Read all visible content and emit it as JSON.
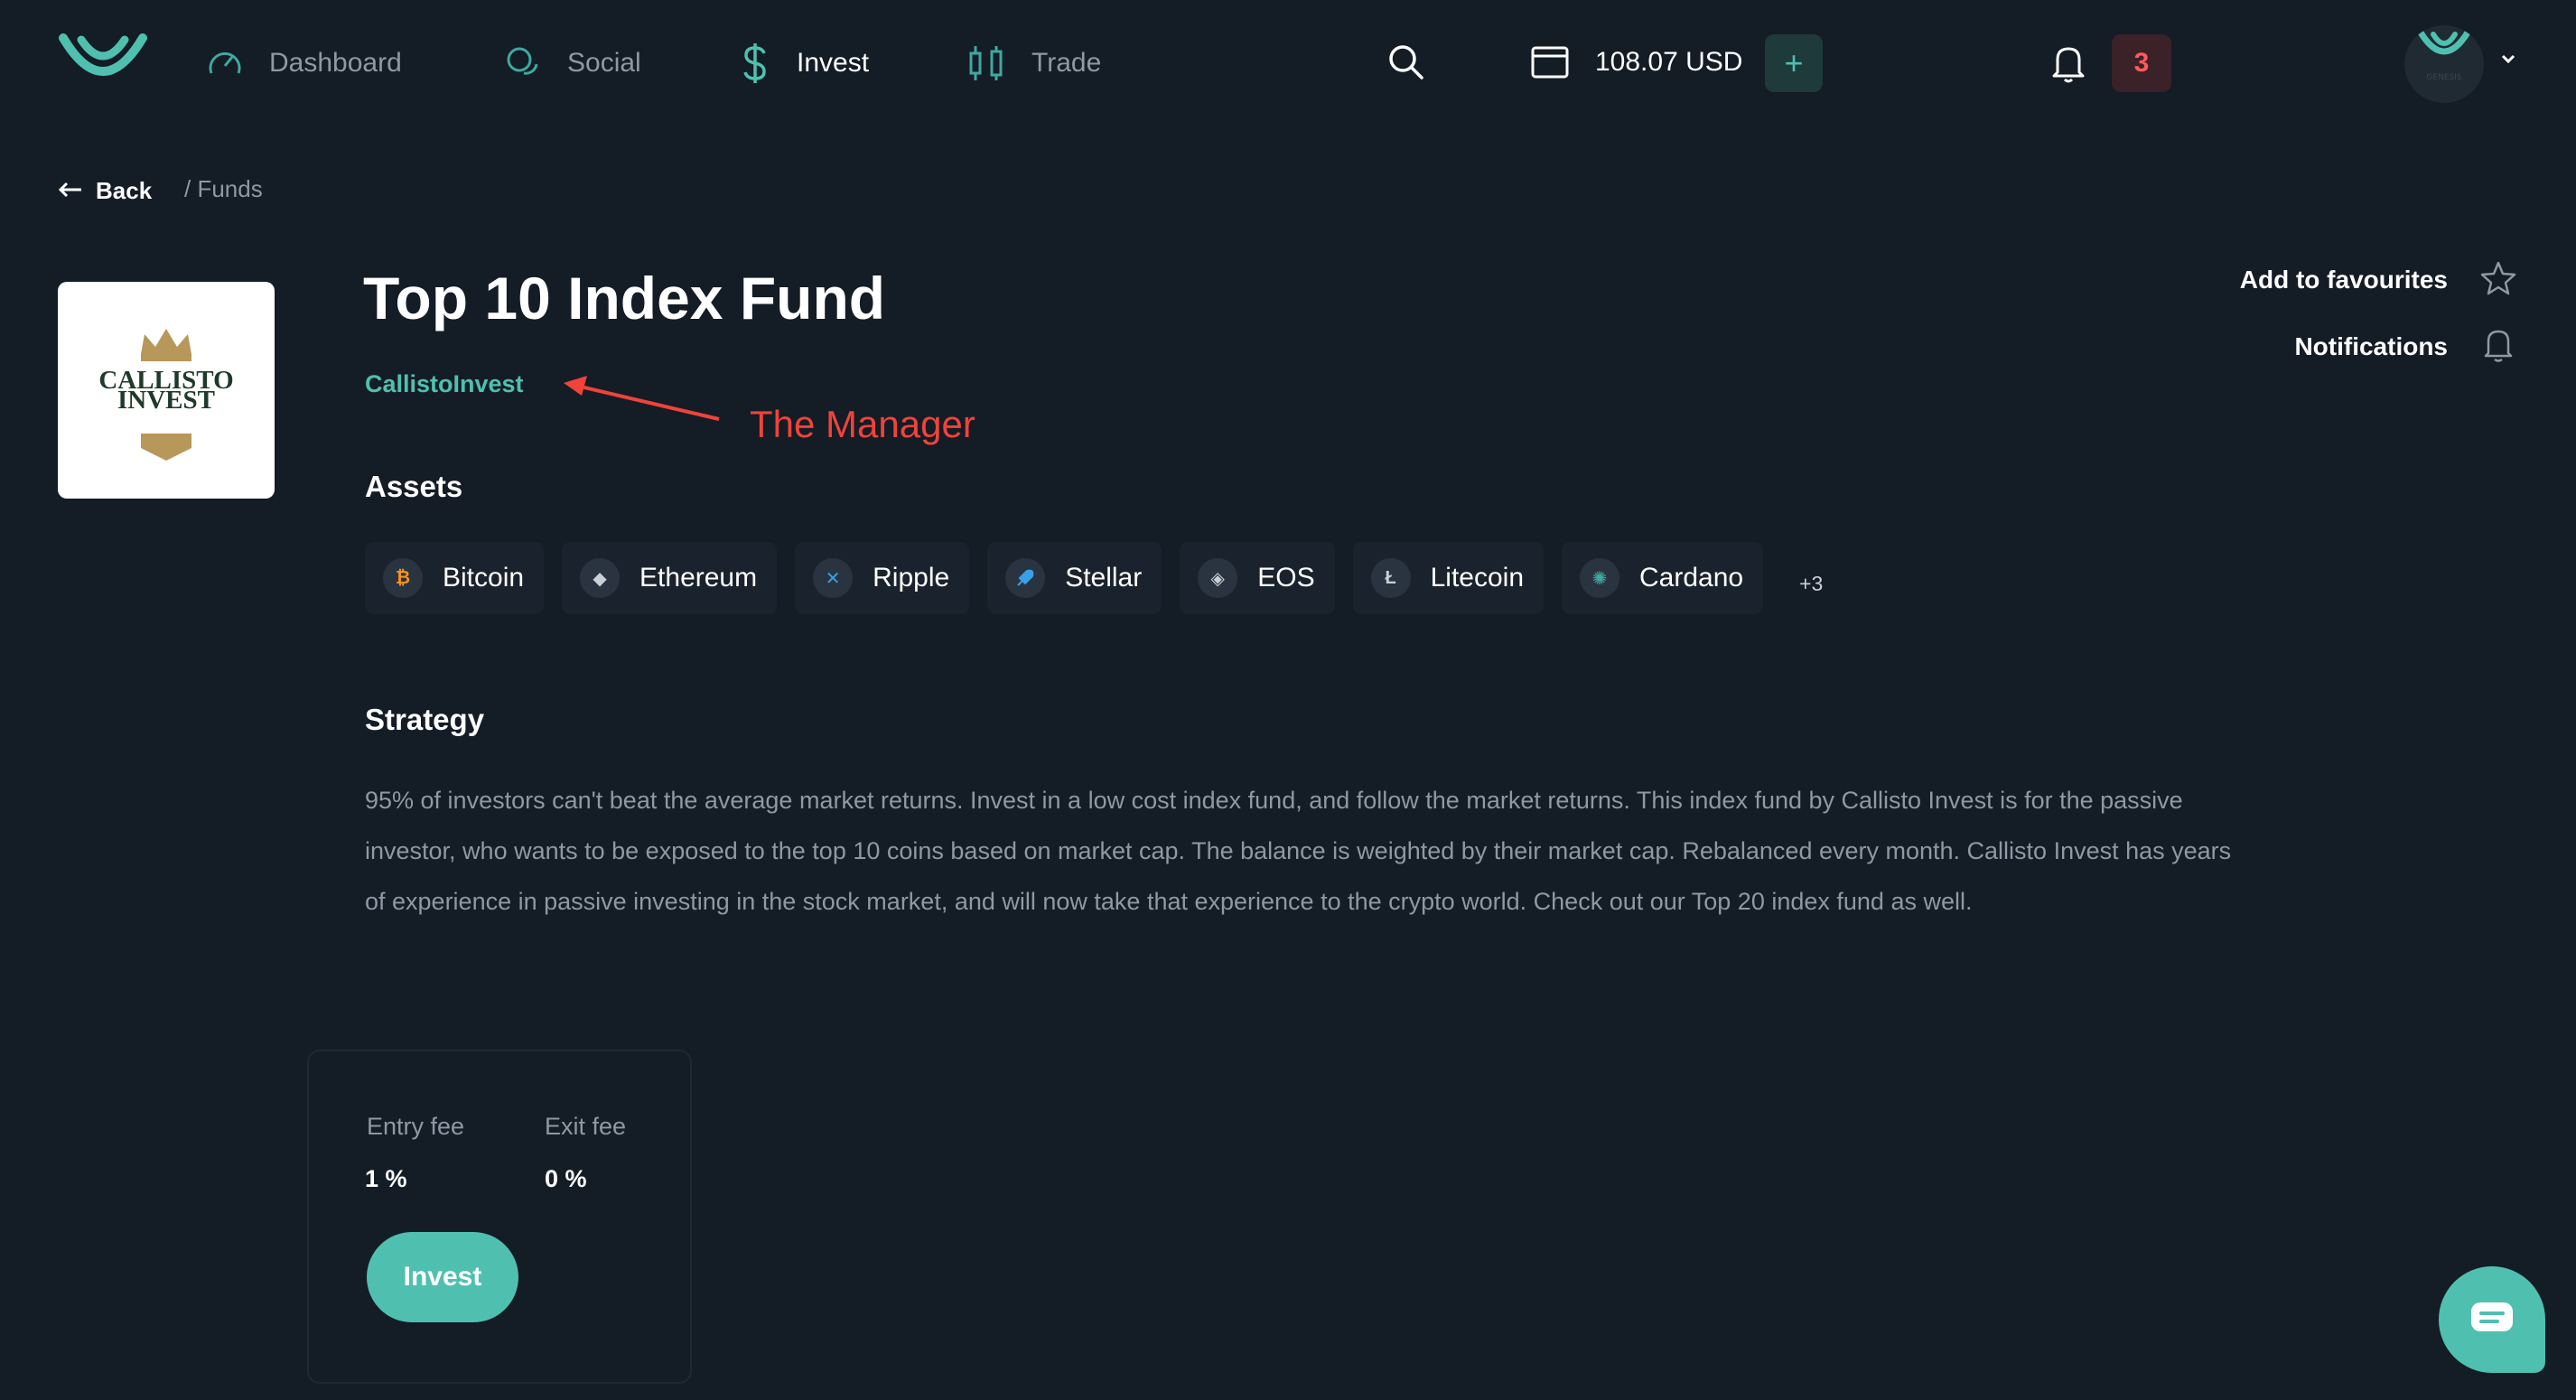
{
  "nav": {
    "items": [
      {
        "label": "Dashboard",
        "icon": "gauge-icon"
      },
      {
        "label": "Social",
        "icon": "chat-bubbles-icon"
      },
      {
        "label": "Invest",
        "icon": "dollar-icon",
        "active": true
      },
      {
        "label": "Trade",
        "icon": "candlestick-icon"
      }
    ],
    "balance": "108.07 USD",
    "add_label": "+",
    "notifications_count": "3",
    "avatar_text": "GENESIS"
  },
  "breadcrumb": {
    "back_label": "Back",
    "path": "/ Funds"
  },
  "fund": {
    "logo_text_line1": "CALLISTO",
    "logo_text_line2": "INVEST",
    "title": "Top 10 Index Fund",
    "manager": "CallistoInvest",
    "annotation": "The Manager",
    "add_favourites": "Add to favourites",
    "notifications": "Notifications"
  },
  "assets": {
    "heading": "Assets",
    "items": [
      {
        "name": "Bitcoin",
        "symbol": "₿",
        "color": "#f7931a"
      },
      {
        "name": "Ethereum",
        "symbol": "◆",
        "color": "#c9d0d6"
      },
      {
        "name": "Ripple",
        "symbol": "✕",
        "color": "#3aa0e6"
      },
      {
        "name": "Stellar",
        "symbol": "🚀",
        "color": "#3aa0e6"
      },
      {
        "name": "EOS",
        "symbol": "◈",
        "color": "#c9d0d6"
      },
      {
        "name": "Litecoin",
        "symbol": "Ł",
        "color": "#c9d0d6"
      },
      {
        "name": "Cardano",
        "symbol": "✺",
        "color": "#3fa8a0"
      }
    ],
    "more": "+3"
  },
  "strategy": {
    "heading": "Strategy",
    "text": "95% of investors can't beat the average market returns. Invest in a low cost index fund, and follow the market returns. This index fund by Callisto Invest is for the passive investor, who wants to be exposed to the top 10 coins based on market cap. The balance is weighted by their market cap. Rebalanced every month. Callisto Invest has years of experience in passive investing in the stock market, and will now take that experience to the crypto world. Check out our Top 20 index fund as well."
  },
  "fees": {
    "entry_label": "Entry fee",
    "entry_value": "1 %",
    "exit_label": "Exit fee",
    "exit_value": "0 %",
    "invest_label": "Invest"
  },
  "colors": {
    "accent": "#4fc0b0",
    "background": "#141c26",
    "annotation": "#f0433a",
    "badge": "#ff5a5a"
  }
}
